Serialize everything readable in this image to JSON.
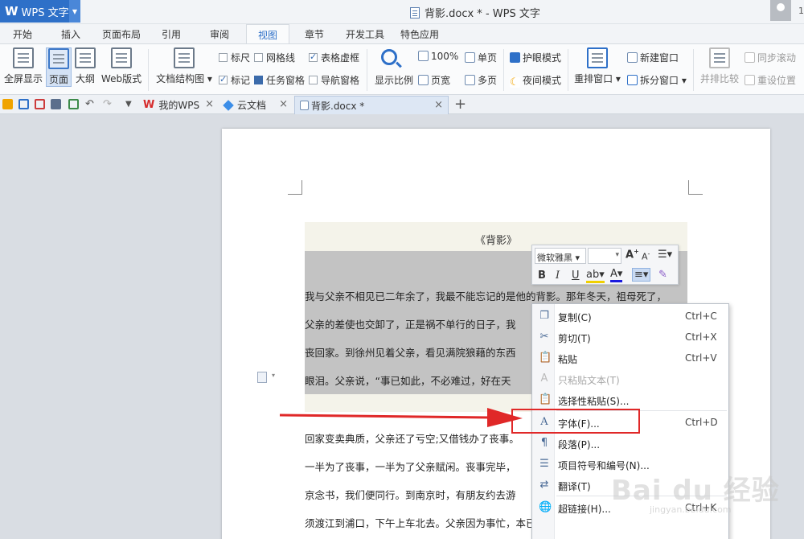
{
  "app": {
    "logo": "W",
    "name": "WPS 文字",
    "window_title": "背影.docx * - WPS 文字",
    "user_number": "1"
  },
  "ribbon_tabs": [
    "开始",
    "插入",
    "页面布局",
    "引用",
    "审阅",
    "视图",
    "章节",
    "开发工具",
    "特色应用"
  ],
  "active_tab": "视图",
  "ribbon": {
    "fullscreen": "全屏显示",
    "page": "页面",
    "outline": "大纲",
    "web": "Web版式",
    "docmap": "文档结构图",
    "ruler": "标尺",
    "grid": "网格线",
    "table_grid": "表格虚框",
    "marks": "标记",
    "task_pane": "任务窗格",
    "nav_pane": "导航窗格",
    "zoom_ratio": "显示比例",
    "zoom_100": "100%",
    "single_page": "单页",
    "page_width": "页宽",
    "multi_page": "多页",
    "eye_mode": "护眼模式",
    "night_mode": "夜间模式",
    "rearrange": "重排窗口",
    "new_window": "新建窗口",
    "split_window": "拆分窗口",
    "side_by_side": "并排比较",
    "sync_scroll": "同步滚动",
    "reset_pos": "重设位置"
  },
  "checks": {
    "ruler": false,
    "grid": false,
    "table_grid": true,
    "marks": true,
    "task_pane": false,
    "nav_pane": false
  },
  "doc_tabs": [
    {
      "label": "我的WPS",
      "active": false
    },
    {
      "label": "云文档",
      "active": false
    },
    {
      "label": "背影.docx *",
      "active": true
    }
  ],
  "document": {
    "title": "《背影》",
    "lines": [
      "我与父亲不相见已二年余了，我最不能忘记的是他的背影。那年冬天，祖母死了，",
      "父亲的差使也交卸了，正是祸不单行的日子，我",
      "丧回家。到徐州见着父亲，看见满院狼藉的东西",
      "眼泪。父亲说，“事已如此，不必难过，好在天",
      "回家变卖典质，父亲还了亏空;又借钱办了丧事。",
      "一半为了丧事，一半为了父亲赋闲。丧事完毕，",
      "京念书，我们便同行。到南京时，有朋友约去游",
      "须渡江到浦口，下午上车北去。父亲因为事忙，本已说定不送我，叫旅馆里一个"
    ]
  },
  "mini_toolbar": {
    "font": "微软雅黑",
    "size": "",
    "bold": "B",
    "italic": "I",
    "underline": "U",
    "grow": "A",
    "font_color": "A"
  },
  "context_menu": [
    {
      "label": "复制(C)",
      "shortcut": "Ctrl+C",
      "icon": "copy-icon",
      "enabled": true
    },
    {
      "label": "剪切(T)",
      "shortcut": "Ctrl+X",
      "icon": "scissors-icon",
      "enabled": true
    },
    {
      "label": "粘贴",
      "shortcut": "Ctrl+V",
      "icon": "paste-icon",
      "enabled": true
    },
    {
      "label": "只粘贴文本(T)",
      "shortcut": "",
      "icon": "paste-text-icon",
      "enabled": false
    },
    {
      "label": "选择性粘贴(S)...",
      "shortcut": "",
      "icon": "paste-special-icon",
      "enabled": true
    },
    {
      "label": "字体(F)...",
      "shortcut": "Ctrl+D",
      "icon": "font-icon",
      "enabled": true
    },
    {
      "label": "段落(P)...",
      "shortcut": "",
      "icon": "paragraph-icon",
      "enabled": true
    },
    {
      "label": "项目符号和编号(N)...",
      "shortcut": "",
      "icon": "bullets-icon",
      "enabled": true
    },
    {
      "label": "翻译(T)",
      "shortcut": "",
      "icon": "translate-icon",
      "enabled": true
    },
    {
      "label": "超链接(H)...",
      "shortcut": "Ctrl+K",
      "icon": "hyperlink-icon",
      "enabled": true
    }
  ],
  "watermark": {
    "text": "Bai du 经验",
    "url": "jingyan.baidu.com"
  },
  "colors": {
    "accent": "#2e70c8",
    "highlight_red": "#e02828"
  }
}
